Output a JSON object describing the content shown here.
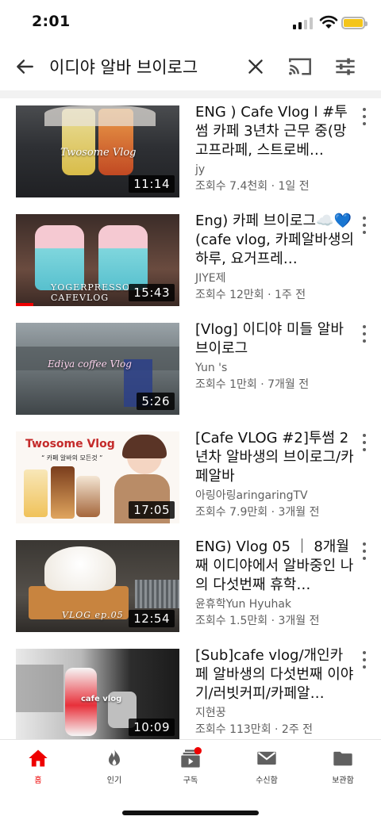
{
  "status_bar": {
    "time": "2:01"
  },
  "search": {
    "query": "이디야 알바 브이로그"
  },
  "results": [
    {
      "title": "ENG ) Cafe Vlog l #투썸 카페 3년차 근무 중(망고프라페, 스트로베…",
      "channel": "jy",
      "stats": "조회수 7.4천회 · 1일 전",
      "duration": "11:14",
      "thumb_text": "Twosome Vlog"
    },
    {
      "title": "Eng) 카페 브이로그☁️💙 (cafe vlog, 카페알바생의 하루, 요거프레…",
      "channel": "JIYE제",
      "stats": "조회수 12만회 · 1주 전",
      "duration": "15:43",
      "thumb_text": "YOGERPRESSO CAFEVLOG"
    },
    {
      "title": "[Vlog] 이디야 미들 알바 브이로그",
      "channel": "Yun 's",
      "stats": "조회수 1만회 · 7개월 전",
      "duration": "5:26",
      "thumb_text": "Ediya coffee Vlog"
    },
    {
      "title": "[Cafe VLOG #2]투썸 2년차 알바생의 브이로그/카페알바",
      "channel": "아링아링aringaringTV",
      "stats": "조회수 7.9만회 · 3개월 전",
      "duration": "17:05",
      "thumb_text": "Twosome Vlog",
      "thumb_subtext": "“ 카페 알바의 모든것 ”"
    },
    {
      "title": "ENG) Vlog 05 ｜ 8개월째 이디야에서 알바중인 나의 다섯번째 휴학…",
      "channel": "윤휴학Yun Hyuhak",
      "stats": "조회수 1.5만회 · 3개월 전",
      "duration": "12:54",
      "thumb_text": "VLOG ep.05"
    },
    {
      "title": "[Sub]cafe vlog/개인카페 알바생의 다섯번째 이야기/러빗커피/카페알…",
      "channel": "지현꿍",
      "stats": "조회수 113만회 · 2주 전",
      "duration": "10:09",
      "thumb_text": "cafe vlog"
    }
  ],
  "nav": [
    {
      "label": "홈",
      "icon": "home-icon",
      "active": true
    },
    {
      "label": "인기",
      "icon": "flame-icon"
    },
    {
      "label": "구독",
      "icon": "subscriptions-icon"
    },
    {
      "label": "수신함",
      "icon": "inbox-icon"
    },
    {
      "label": "보관함",
      "icon": "library-icon"
    }
  ],
  "colors": {
    "accent": "#ee0000",
    "text_secondary": "#606060"
  }
}
